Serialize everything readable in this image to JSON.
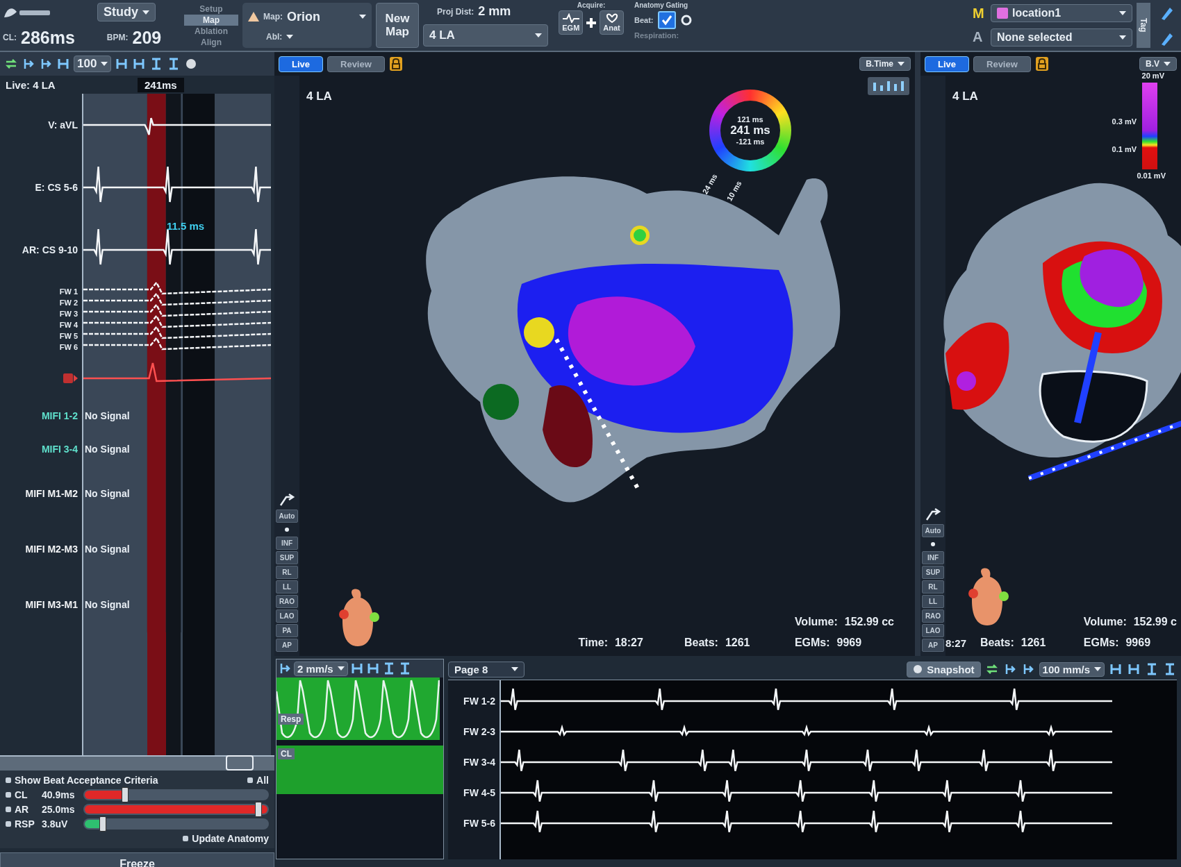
{
  "toolbar": {
    "study": "Study",
    "cl": {
      "label": "CL:",
      "value": "286ms"
    },
    "bpm": {
      "label": "BPM:",
      "value": "209"
    },
    "modes": [
      {
        "label": "Setup",
        "selected": false
      },
      {
        "label": "Map",
        "selected": true
      },
      {
        "label": "Ablation",
        "selected": false
      },
      {
        "label": "Align",
        "selected": false
      }
    ],
    "map": {
      "label": "Map:",
      "value": "Orion",
      "abl_label": "Abl:"
    },
    "new_map": "New Map",
    "proj_dist": {
      "label": "Proj Dist:",
      "value": "2 mm"
    },
    "map_select": "4 LA",
    "acquire": {
      "title": "Acquire:",
      "buttons": [
        "EGM",
        "Anat"
      ]
    },
    "gating": {
      "title": "Anatomy Gating",
      "beat_label": "Beat:",
      "beat_checked": true,
      "respiration_label": "Respiration:"
    },
    "location": {
      "badge": "M",
      "name": "location1",
      "color": "#e070e0"
    },
    "anatomy": {
      "badge": "A",
      "value": "None selected"
    },
    "tag": "Tag"
  },
  "left_panel": {
    "zoom": "100",
    "title": "Live: 4 LA",
    "window": "241ms",
    "channels": [
      {
        "kind": "trace",
        "label": "V: aVL"
      },
      {
        "kind": "trace",
        "label": "E: CS 5-6"
      },
      {
        "kind": "trace",
        "label": "AR: CS 9-10",
        "measure": "11.5 ms"
      },
      {
        "kind": "group",
        "labels": [
          "FW 1",
          "FW 2",
          "FW 3",
          "FW 4",
          "FW 5",
          "FW 6"
        ]
      },
      {
        "kind": "marker"
      },
      {
        "kind": "mifi",
        "label": "MIFI 1-2",
        "value": "No Signal",
        "color": "#5fe0cc"
      },
      {
        "kind": "mifi",
        "label": "MIFI 3-4",
        "value": "No Signal",
        "color": "#5fe0cc"
      },
      {
        "kind": "mifi",
        "label": "MIFI M1-M2",
        "value": "No Signal",
        "color": "#f2f4f6"
      },
      {
        "kind": "mifi",
        "label": "MIFI M2-M3",
        "value": "No Signal",
        "color": "#f2f4f6"
      },
      {
        "kind": "mifi",
        "label": "MIFI M3-M1",
        "value": "No Signal",
        "color": "#f2f4f6"
      }
    ],
    "beat_acceptance": {
      "show": {
        "label": "Show Beat Acceptance Criteria",
        "checked": false
      },
      "all": {
        "label": "All",
        "checked": false
      },
      "sliders": [
        {
          "name": "CL",
          "checked": false,
          "reading": "40.9ms",
          "level": 0.22,
          "color": "#e02828"
        },
        {
          "name": "AR",
          "checked": false,
          "reading": "25.0ms",
          "level": 1,
          "color": "#e02828"
        },
        {
          "name": "RSP",
          "checked": false,
          "reading": "3.8uV",
          "level": 0.1,
          "color": "#2ec070"
        }
      ],
      "update": {
        "label": "Update Anatomy",
        "checked": false
      }
    },
    "freeze": "Freeze"
  },
  "maps": [
    {
      "tabs": [
        {
          "label": "Live",
          "selected": true
        },
        {
          "label": "Review",
          "selected": false
        }
      ],
      "view": "4 LA",
      "dropdown": "B.Time",
      "wheel": {
        "top": "121 ms",
        "center": "241 ms",
        "bottom": "-121 ms",
        "marks": [
          "24 ms",
          "10 ms"
        ]
      },
      "views": [
        "Auto",
        "INF",
        "SUP",
        "RL",
        "LL",
        "RAO",
        "LAO",
        "PA",
        "AP"
      ],
      "stats": [
        {
          "label": "Volume:",
          "value": "152.99 cc"
        },
        {
          "label": "Time:",
          "value": "18:27"
        },
        {
          "label": "Beats:",
          "value": "1261"
        },
        {
          "label": "EGMs:",
          "value": "9969"
        }
      ]
    },
    {
      "tabs": [
        {
          "label": "Live",
          "selected": true
        },
        {
          "label": "Review",
          "selected": false
        }
      ],
      "view": "4 LA",
      "dropdown": "B.V",
      "scale": [
        "20 mV",
        "0.3 mV",
        "0.1 mV",
        "0.01 mV"
      ],
      "views": [
        "Auto",
        "INF",
        "SUP",
        "RL",
        "LL",
        "RAO",
        "LAO",
        "AP"
      ],
      "clipped_time": "8:27",
      "stats": [
        {
          "label": "Volume:",
          "value": "152.99 c"
        },
        {
          "label": "Beats:",
          "value": "1261"
        },
        {
          "label": "EGMs:",
          "value": "9969"
        }
      ]
    }
  ],
  "resp_panel": {
    "speed": "2 mm/s",
    "labels": [
      "Resp",
      "CL"
    ]
  },
  "egm_panel": {
    "page": "Page 8",
    "snapshot": "Snapshot",
    "speed": "100 mm/s",
    "channels": [
      "FW 1-2",
      "FW 2-3",
      "FW 3-4",
      "FW 4-5",
      "FW 5-6"
    ]
  }
}
